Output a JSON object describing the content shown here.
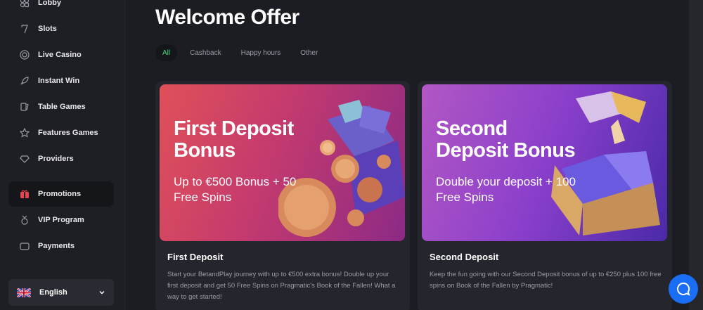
{
  "sidebar": {
    "items": [
      {
        "label": "Lobby",
        "icon": "lobby-icon"
      },
      {
        "label": "Slots",
        "icon": "slots-icon"
      },
      {
        "label": "Live Casino",
        "icon": "live-casino-icon"
      },
      {
        "label": "Instant Win",
        "icon": "rocket-icon"
      },
      {
        "label": "Table Games",
        "icon": "cards-icon"
      },
      {
        "label": "Features Games",
        "icon": "star-icon"
      },
      {
        "label": "Providers",
        "icon": "diamond-icon"
      },
      {
        "label": "Promotions",
        "icon": "gift-icon"
      },
      {
        "label": "VIP Program",
        "icon": "vip-icon"
      },
      {
        "label": "Payments",
        "icon": "wallet-icon"
      }
    ],
    "language": {
      "label": "English",
      "flag": "uk-flag-icon"
    }
  },
  "main": {
    "title": "Welcome Offer",
    "tabs": [
      {
        "label": "All",
        "active": true
      },
      {
        "label": "Cashback"
      },
      {
        "label": "Happy hours"
      },
      {
        "label": "Other"
      }
    ],
    "cards": [
      {
        "banner_title": "First Deposit Bonus",
        "banner_subtitle": "Up to €500 Bonus + 50 Free Spins",
        "title": "First Deposit",
        "description": "Start your BetandPlay journey with up to €500 extra bonus! Double up your first deposit and get 50 Free Spins on Pragmatic's Book of the Fallen! What a way to get started!"
      },
      {
        "banner_title": "Second Deposit Bonus",
        "banner_subtitle": "Double your deposit + 100 Free Spins",
        "title": "Second Deposit",
        "description": "Keep the fun going with our Second Deposit bonus of up to €250 plus 100 free spins on Book of the Fallen by Pragmatic!"
      }
    ]
  },
  "colors": {
    "accent_green": "#4ade80",
    "chat_blue": "#1a6ef5",
    "promo_red": "#e8434f"
  },
  "chat": {
    "icon": "chat-bubble-icon"
  }
}
